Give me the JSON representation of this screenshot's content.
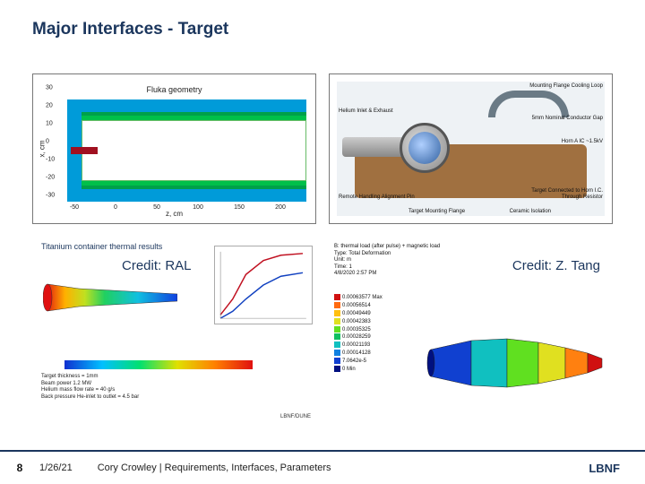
{
  "title": "Major Interfaces - Target",
  "fluka": {
    "title": "Fluka geometry",
    "ylabel": "x, cm",
    "xlabel": "z, cm",
    "xticks": [
      "-50",
      "0",
      "50",
      "100",
      "150",
      "200"
    ],
    "yticks": [
      "-30",
      "-20",
      "-10",
      "0",
      "10",
      "20",
      "30"
    ]
  },
  "cad": {
    "labels": {
      "flange": "Mounting Flange Cooling Loop",
      "gap": "5mm Nominal Conductor Gap",
      "horn": "Horn A IC ~1.5kV",
      "he": "Helium Inlet & Exhaust",
      "pin": "Remote Handling Alignment Pin",
      "mount": "Target Mounting Flange",
      "iso": "Ceramic Isolation",
      "conn": "Target Connected to Horn I.C. Through Resistor"
    }
  },
  "ral": {
    "title": "Titanium container thermal results",
    "credit": "Credit: RAL",
    "notes": [
      "Target thickness = 1mm",
      "Beam power 1.2 MW",
      "Helium mass flow rate = 40 g/s",
      "Back pressure He-inlet to outlet = 4.5 bar"
    ],
    "logo": "LBNF/DUNE"
  },
  "tang": {
    "credit": "Credit: Z. Tang",
    "heading": "B: thermal load (after pulse) + magnetic load",
    "sub1": "Type: Total Deformation",
    "sub2": "Unit: m",
    "sub3": "Time: 1",
    "sub4": "4/8/2020 2:57 PM",
    "legend": [
      {
        "c": "#d01010",
        "v": "0.00063577 Max"
      },
      {
        "c": "#ff6a10",
        "v": "0.00056514"
      },
      {
        "c": "#ffc010",
        "v": "0.00049449"
      },
      {
        "c": "#e0e020",
        "v": "0.00042383"
      },
      {
        "c": "#60e020",
        "v": "0.00035325"
      },
      {
        "c": "#10c060",
        "v": "0.00028259"
      },
      {
        "c": "#10c0c0",
        "v": "0.00021193"
      },
      {
        "c": "#1080e0",
        "v": "0.00014128"
      },
      {
        "c": "#1040d0",
        "v": "7.0642e-5"
      },
      {
        "c": "#001080",
        "v": "0 Min"
      }
    ]
  },
  "footer": {
    "page": "8",
    "date": "1/26/21",
    "author": "Cory Crowley | Requirements, Interfaces, Parameters",
    "brand": "LBNF"
  }
}
